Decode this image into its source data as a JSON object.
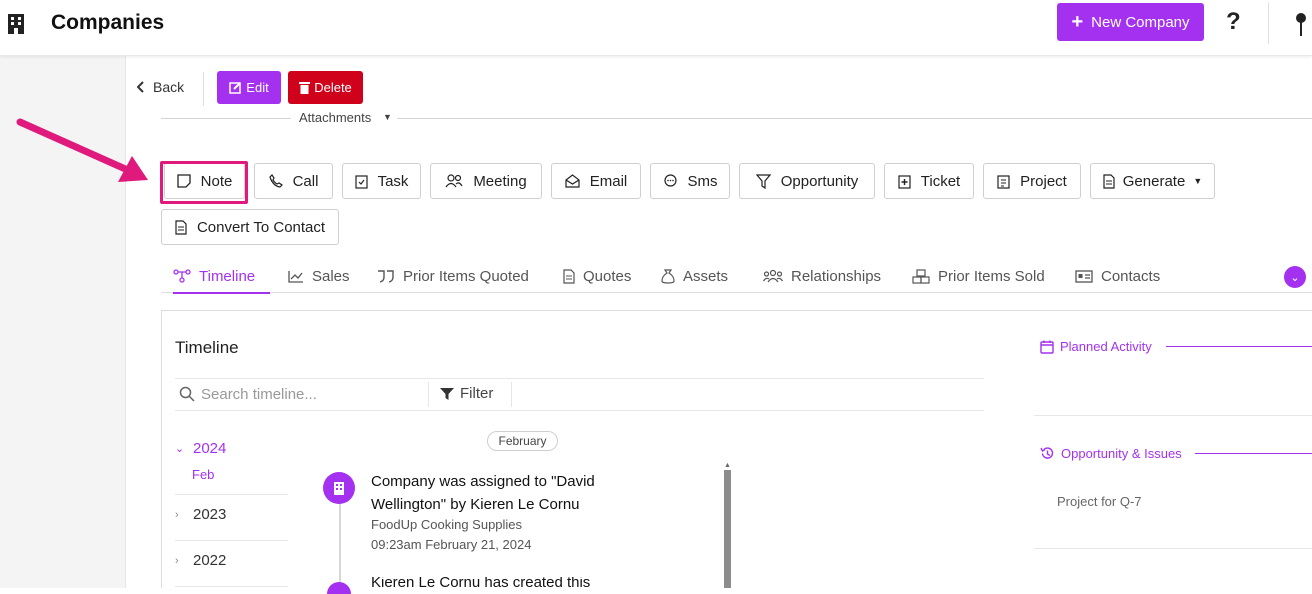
{
  "header": {
    "title": "Companies",
    "new_button_label": "New Company",
    "help_label": "?"
  },
  "toolbar": {
    "back_label": "Back",
    "edit_label": "Edit",
    "delete_label": "Delete",
    "attachments_label": "Attachments"
  },
  "actions": {
    "note": "Note",
    "call": "Call",
    "task": "Task",
    "meeting": "Meeting",
    "email": "Email",
    "sms": "Sms",
    "opportunity": "Opportunity",
    "ticket": "Ticket",
    "project": "Project",
    "generate": "Generate",
    "convert": "Convert To Contact"
  },
  "tabs": {
    "timeline": "Timeline",
    "sales": "Sales",
    "prior_quoted": "Prior Items Quoted",
    "quotes": "Quotes",
    "assets": "Assets",
    "relationships": "Relationships",
    "prior_sold": "Prior Items Sold",
    "contacts": "Contacts"
  },
  "timeline": {
    "title": "Timeline",
    "search_placeholder": "Search timeline...",
    "filter_label": "Filter",
    "years": [
      "2024",
      "2023",
      "2022"
    ],
    "active_month": "Feb",
    "month_pill": "February",
    "event": {
      "title": "Company was assigned to \"David Wellington\" by Kieren Le Cornu",
      "company": "FoodUp Cooking Supplies",
      "time": "09:23am February 21, 2024"
    },
    "event2_partial": "Kieren Le Cornu has created this company"
  },
  "side": {
    "planned_label": "Planned Activity",
    "opp_label": "Opportunity & Issues",
    "opp_item": "Project for Q-7"
  },
  "colors": {
    "accent": "#a431f0",
    "danger": "#d0021b",
    "highlight": "#e0197d"
  }
}
